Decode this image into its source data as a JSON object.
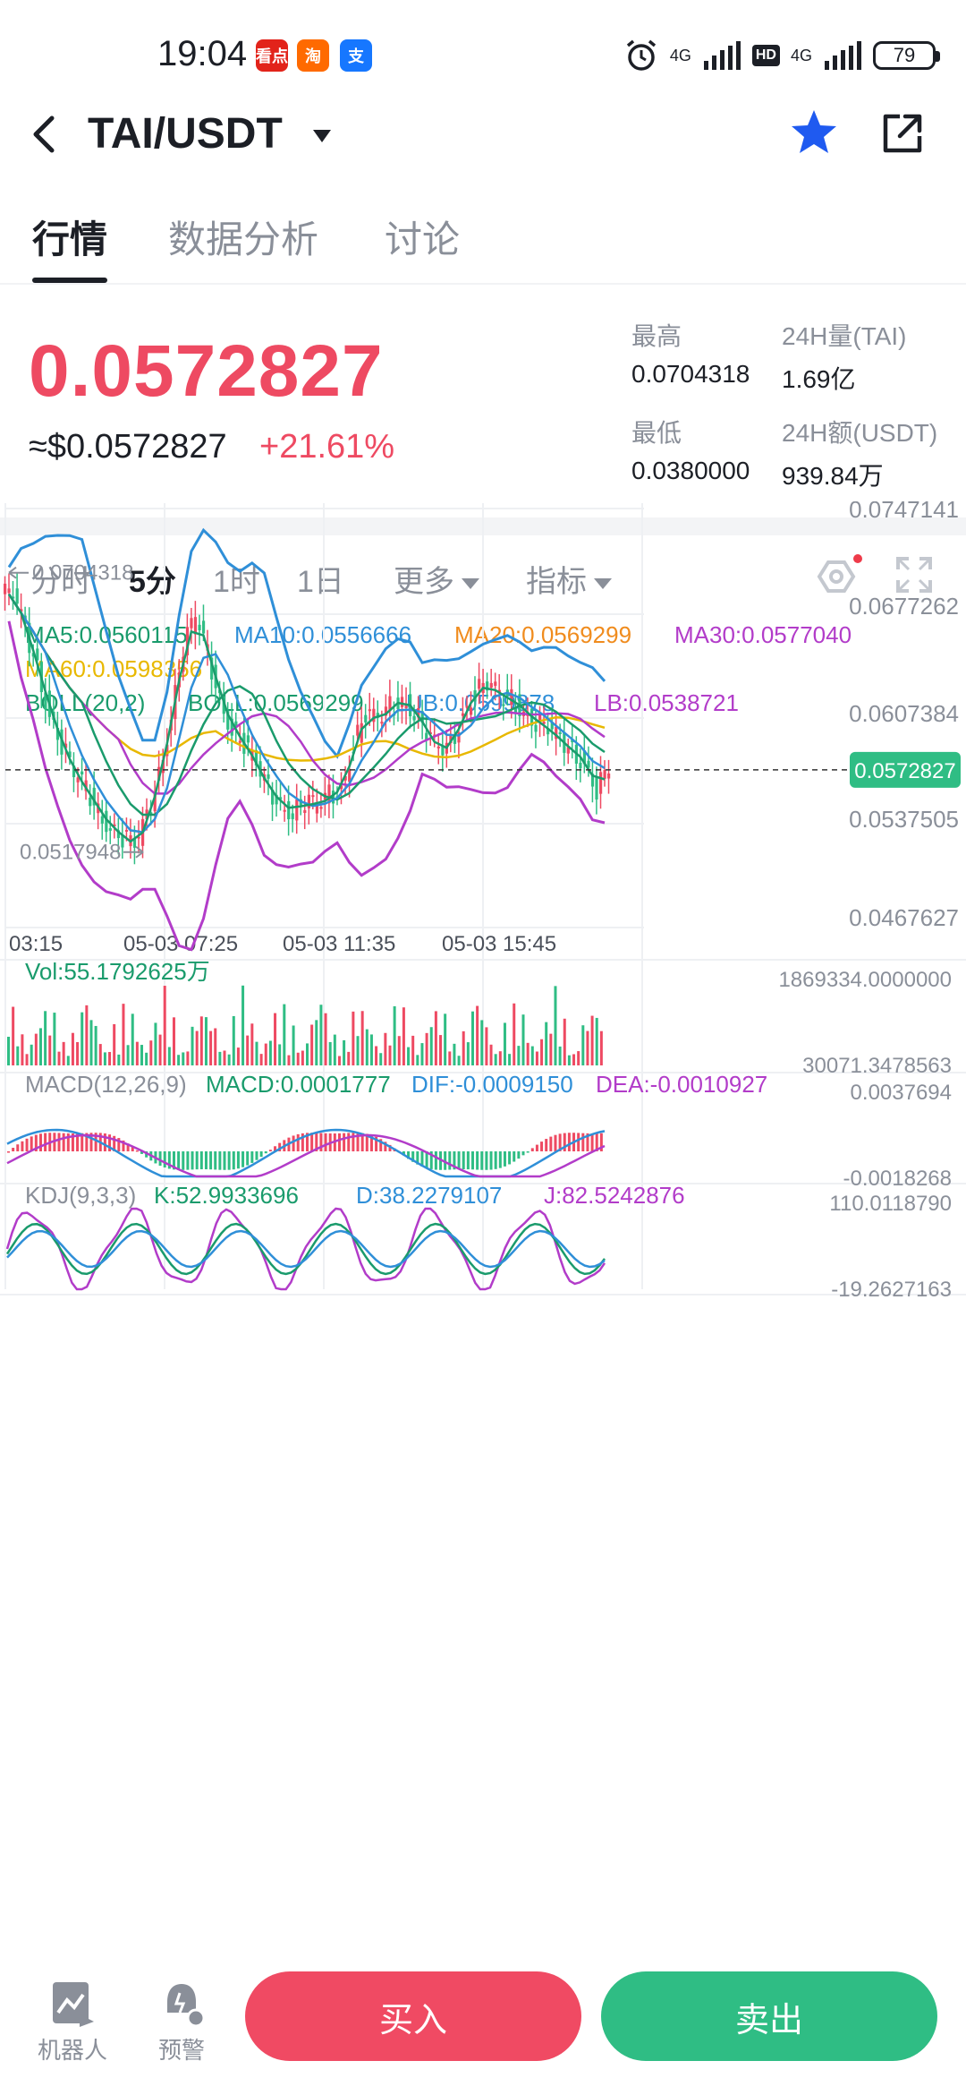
{
  "status": {
    "time": "19:04",
    "apps": [
      {
        "label": "看点",
        "color": "#e2231a"
      },
      {
        "label": "淘",
        "color": "#ff6a00"
      },
      {
        "label": "支",
        "color": "#1677ff"
      }
    ],
    "net1": "4G",
    "hd": "HD",
    "net2": "4G",
    "battery": "79"
  },
  "header": {
    "pair": "TAI/USDT"
  },
  "tabs": [
    "行情",
    "数据分析",
    "讨论"
  ],
  "price": {
    "last": "0.0572827",
    "usd": "≈$0.0572827",
    "change": "+21.61%"
  },
  "stats": {
    "high_label": "最高",
    "high_value": "0.0704318",
    "vol_label": "24H量(TAI)",
    "vol_value": "1.69亿",
    "low_label": "最低",
    "low_value": "0.0380000",
    "amt_label": "24H额(USDT)",
    "amt_value": "939.84万"
  },
  "intervals": [
    "分时",
    "5分",
    "1时",
    "1日",
    "更多",
    "指标"
  ],
  "legend": {
    "ma5": "MA5:0.0560115",
    "ma10": "MA10:0.0556666",
    "ma20": "MA20:0.0569299",
    "ma30": "MA30:0.0577040",
    "ma60": "MA60:0.0598356",
    "boll_name": "BOLL(20,2)",
    "boll": "BOLL:0.0569299",
    "ub": "UB:0.0599878",
    "lb": "LB:0.0538721"
  },
  "colors": {
    "up": "#ee4a62",
    "down": "#2fbd84",
    "ma5": "#1a9b6c",
    "ma10": "#2f8fd8",
    "ma20": "#f08c1e",
    "ma30": "#b23cc9",
    "ma60": "#e8b800",
    "boll": "#1a9b6c"
  },
  "chart_data": {
    "type": "candlestick",
    "yaxis_ticks": [
      "0.0747141",
      "0.0677262",
      "0.0607384",
      "0.0537505",
      "0.0467627"
    ],
    "ylim": [
      0.0467627,
      0.0747141
    ],
    "x_ticks": [
      "03:15",
      "05-03 07:25",
      "05-03 11:35",
      "05-03 15:45"
    ],
    "last_price_tag": "0.0572827",
    "last_price": 0.0572827,
    "high_marker": "0.0704318",
    "high_value": 0.0704318,
    "low_marker": "0.0517948",
    "low_value": 0.0517948,
    "volume": {
      "label": "Vol:55.1792625万",
      "max_label": "1869334.0000000",
      "min_label": "30071.3478563"
    },
    "macd": {
      "name": "MACD(12,26,9)",
      "macd": "MACD:0.0001777",
      "dif": "DIF:-0.0009150",
      "dea": "DEA:-0.0010927",
      "max_label": "0.0037694",
      "min_label": "-0.0018268"
    },
    "kdj": {
      "name": "KDJ(9,3,3)",
      "k": "K:52.9933696",
      "d": "D:38.2279107",
      "j": "J:82.5242876",
      "max_label": "110.0118790",
      "min_label": "-19.2627163"
    },
    "close_series": [
      0.069,
      0.0665,
      0.064,
      0.061,
      0.059,
      0.057,
      0.056,
      0.0545,
      0.0535,
      0.0528,
      0.0522,
      0.054,
      0.057,
      0.061,
      0.0655,
      0.0675,
      0.065,
      0.062,
      0.06,
      0.059,
      0.0575,
      0.056,
      0.055,
      0.0545,
      0.0552,
      0.0548,
      0.0556,
      0.056,
      0.059,
      0.061,
      0.0605,
      0.0615,
      0.062,
      0.0612,
      0.0598,
      0.0585,
      0.059,
      0.061,
      0.0625,
      0.063,
      0.0622,
      0.062,
      0.0612,
      0.0605,
      0.06,
      0.0592,
      0.0585,
      0.0578,
      0.056,
      0.0573
    ]
  },
  "bottom": {
    "robot": "机器人",
    "alert": "预警",
    "buy": "买入",
    "sell": "卖出"
  }
}
